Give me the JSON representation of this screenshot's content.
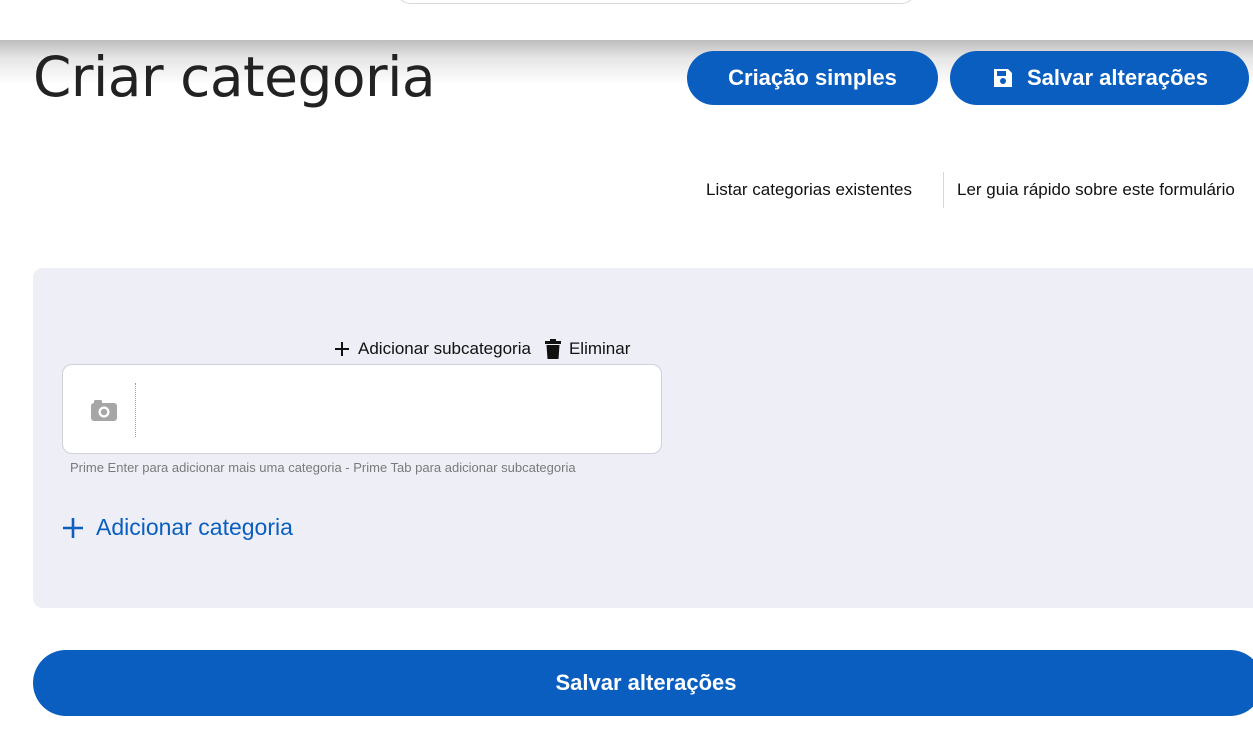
{
  "header": {
    "title": "Criar categoria",
    "simple_button_label": "Criação simples",
    "save_button_label": "Salvar alterações",
    "save_icon": "floppy-disk-icon"
  },
  "links": {
    "list_label": "Listar categorias existentes",
    "guide_label": "Ler guia rápido sobre este formulário"
  },
  "category_editor": {
    "add_subcategory_label": "Adicionar subcategoria",
    "delete_label": "Eliminar",
    "name_value": "",
    "photo_icon": "camera-icon",
    "hint": "Prime Enter para adicionar mais uma categoria - Prime Tab para adicionar subcategoria",
    "add_category_label": "Adicionar categoria"
  },
  "footer": {
    "save_button_label": "Salvar alterações"
  },
  "colors": {
    "primary": "#0a5ec0",
    "panel_background": "#edeef6"
  }
}
